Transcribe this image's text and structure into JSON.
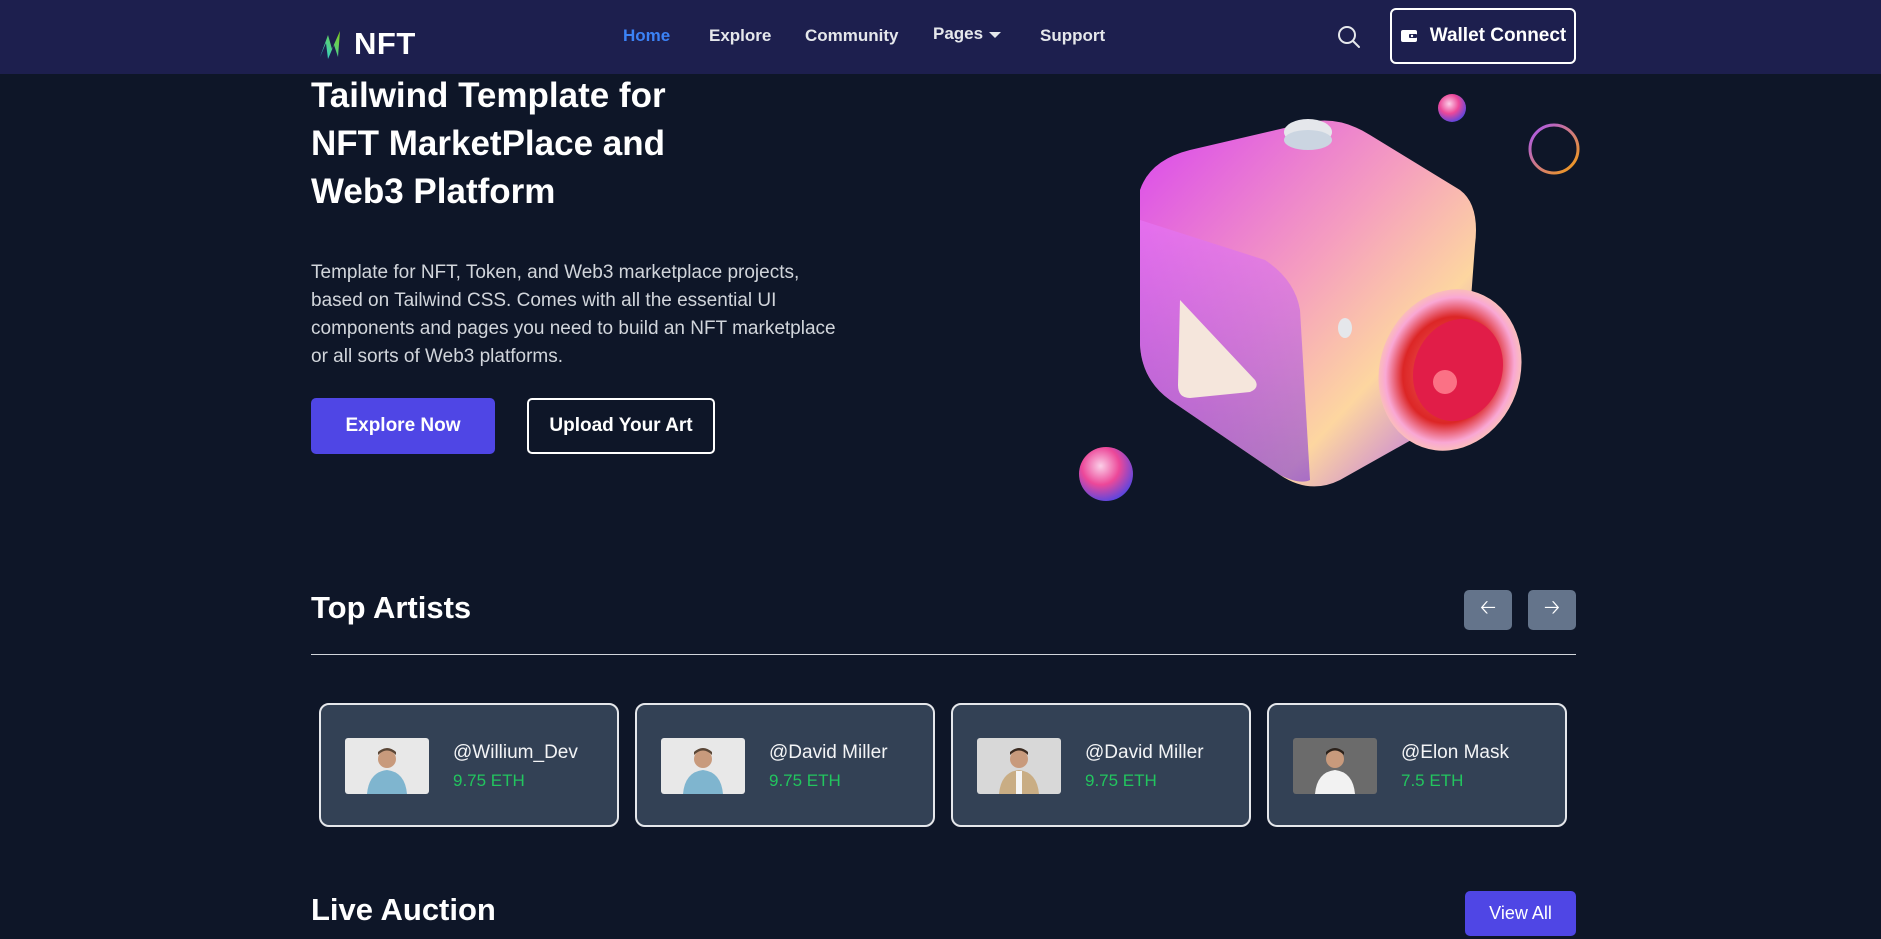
{
  "header": {
    "logo_text": "NFT",
    "nav": [
      {
        "label": "Home",
        "active": true
      },
      {
        "label": "Explore",
        "active": false
      },
      {
        "label": "Community",
        "active": false
      },
      {
        "label": "Pages",
        "active": false,
        "has_dropdown": true
      },
      {
        "label": "Support",
        "active": false
      }
    ],
    "search_icon": "search-icon",
    "wallet_label": "Wallet Connect",
    "wallet_icon": "wallet-icon"
  },
  "hero": {
    "title_lines": [
      "Tailwind Template for",
      "NFT MarketPlace and",
      "Web3 Platform"
    ],
    "description": "Template for NFT, Token, and Web3 marketplace projects, based on Tailwind CSS. Comes with all the essential UI components and pages you need to build an NFT marketplace or all sorts of Web3 platforms.",
    "primary_button": "Explore Now",
    "secondary_button": "Upload Your Art"
  },
  "top_artists": {
    "title": "Top Artists",
    "prev_icon": "arrow-left-icon",
    "next_icon": "arrow-right-icon",
    "artists": [
      {
        "name": "@Willium_Dev",
        "price": "9.75 ETH",
        "shirt": "#7fb5cf"
      },
      {
        "name": "@David Miller",
        "price": "9.75 ETH",
        "shirt": "#7fb5cf"
      },
      {
        "name": "@David Miller",
        "price": "9.75 ETH",
        "shirt": "#c9ad84"
      },
      {
        "name": "@Elon Mask",
        "price": "7.5 ETH",
        "shirt": "#f2f2f2"
      }
    ]
  },
  "live_auction": {
    "title": "Live Auction",
    "view_all": "View All"
  },
  "colors": {
    "background": "#0e1628",
    "navbar": "#1d1f4e",
    "accent": "#4f46e5",
    "active_link": "#3b82f6",
    "card": "#334155",
    "price": "#22c55e"
  }
}
